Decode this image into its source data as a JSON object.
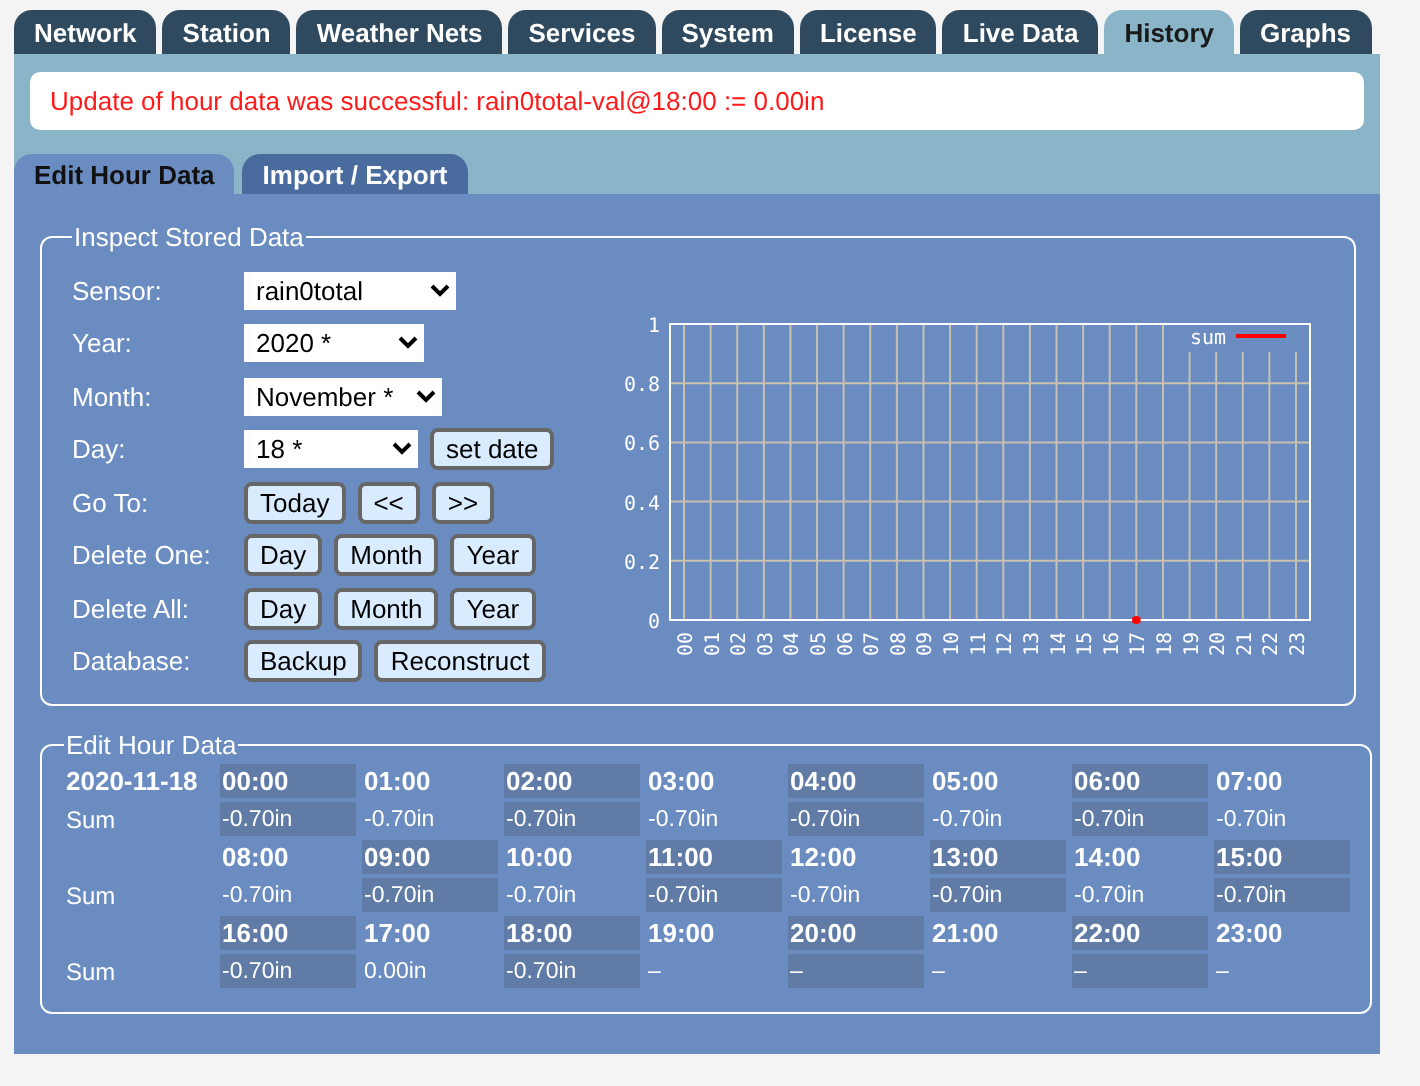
{
  "tabs": [
    {
      "label": "Network",
      "selected": false
    },
    {
      "label": "Station",
      "selected": false
    },
    {
      "label": "Weather Nets",
      "selected": false
    },
    {
      "label": "Services",
      "selected": false
    },
    {
      "label": "System",
      "selected": false
    },
    {
      "label": "License",
      "selected": false
    },
    {
      "label": "Live Data",
      "selected": false
    },
    {
      "label": "History",
      "selected": true
    },
    {
      "label": "Graphs",
      "selected": false
    }
  ],
  "message": "Update of hour data was successful: rain0total-val@18:00 := 0.00in",
  "subtabs": [
    {
      "label": "Edit Hour Data",
      "selected": true
    },
    {
      "label": "Import / Export",
      "selected": false
    }
  ],
  "inspect": {
    "legend": "Inspect Stored Data",
    "rows": [
      {
        "label": "Sensor:",
        "controls": [
          {
            "kind": "select",
            "value": "rain0total"
          }
        ]
      },
      {
        "label": "Year:",
        "controls": [
          {
            "kind": "select",
            "value": "2020 *"
          }
        ]
      },
      {
        "label": "Month:",
        "controls": [
          {
            "kind": "select",
            "value": "November *"
          }
        ]
      },
      {
        "label": "Day:",
        "controls": [
          {
            "kind": "select",
            "value": "18 *"
          },
          {
            "kind": "button",
            "label": "set date"
          }
        ]
      },
      {
        "label": "Go To:",
        "controls": [
          {
            "kind": "button",
            "label": "Today"
          },
          {
            "kind": "button",
            "label": "<<"
          },
          {
            "kind": "button",
            "label": ">>"
          }
        ]
      },
      {
        "label": "Delete One:",
        "controls": [
          {
            "kind": "button",
            "label": "Day"
          },
          {
            "kind": "button",
            "label": "Month"
          },
          {
            "kind": "button",
            "label": "Year"
          }
        ]
      },
      {
        "label": "Delete All:",
        "controls": [
          {
            "kind": "button",
            "label": "Day"
          },
          {
            "kind": "button",
            "label": "Month"
          },
          {
            "kind": "button",
            "label": "Year"
          }
        ]
      },
      {
        "label": "Database:",
        "controls": [
          {
            "kind": "button",
            "label": "Backup"
          },
          {
            "kind": "button",
            "label": "Reconstruct"
          }
        ]
      }
    ],
    "chart_data": {
      "type": "line",
      "categories": [
        "00",
        "01",
        "02",
        "03",
        "04",
        "05",
        "06",
        "07",
        "08",
        "09",
        "10",
        "11",
        "12",
        "13",
        "14",
        "15",
        "16",
        "17",
        "18",
        "19",
        "20",
        "21",
        "22",
        "23"
      ],
      "series": [
        {
          "name": "sum",
          "color": "#ff0000",
          "marker": "dot",
          "values": [
            null,
            null,
            null,
            null,
            null,
            null,
            null,
            null,
            null,
            null,
            null,
            null,
            null,
            null,
            null,
            null,
            null,
            0,
            null,
            null,
            null,
            null,
            null,
            null
          ]
        }
      ],
      "grid": true,
      "ylim": [
        0,
        1
      ],
      "yticks": [
        0,
        {
          "value": 0.2,
          "label": "0.2"
        },
        {
          "value": 0.4,
          "label": "0.4"
        },
        {
          "value": 0.6,
          "label": "0.6"
        },
        {
          "value": 0.8,
          "label": "0.8"
        },
        1
      ]
    }
  },
  "hour_data": {
    "legend": "Edit Hour Data",
    "date": "2020-11-18",
    "blocks": [
      {
        "label": "Sum",
        "cells": [
          {
            "hour": "00:00",
            "value": "-0.70in"
          },
          {
            "hour": "01:00",
            "value": "-0.70in"
          },
          {
            "hour": "02:00",
            "value": "-0.70in"
          },
          {
            "hour": "03:00",
            "value": "-0.70in"
          },
          {
            "hour": "04:00",
            "value": "-0.70in"
          },
          {
            "hour": "05:00",
            "value": "-0.70in"
          },
          {
            "hour": "06:00",
            "value": "-0.70in"
          },
          {
            "hour": "07:00",
            "value": "-0.70in"
          }
        ]
      },
      {
        "label": "Sum",
        "cells": [
          {
            "hour": "08:00",
            "value": "-0.70in"
          },
          {
            "hour": "09:00",
            "value": "-0.70in"
          },
          {
            "hour": "10:00",
            "value": "-0.70in"
          },
          {
            "hour": "11:00",
            "value": "-0.70in"
          },
          {
            "hour": "12:00",
            "value": "-0.70in"
          },
          {
            "hour": "13:00",
            "value": "-0.70in"
          },
          {
            "hour": "14:00",
            "value": "-0.70in"
          },
          {
            "hour": "15:00",
            "value": "-0.70in"
          }
        ]
      },
      {
        "label": "Sum",
        "cells": [
          {
            "hour": "16:00",
            "value": "-0.70in"
          },
          {
            "hour": "17:00",
            "value": "0.00in"
          },
          {
            "hour": "18:00",
            "value": "-0.70in"
          },
          {
            "hour": "19:00",
            "value": "–"
          },
          {
            "hour": "20:00",
            "value": "–"
          },
          {
            "hour": "21:00",
            "value": "–"
          },
          {
            "hour": "22:00",
            "value": "–"
          },
          {
            "hour": "23:00",
            "value": "–"
          }
        ]
      }
    ]
  }
}
